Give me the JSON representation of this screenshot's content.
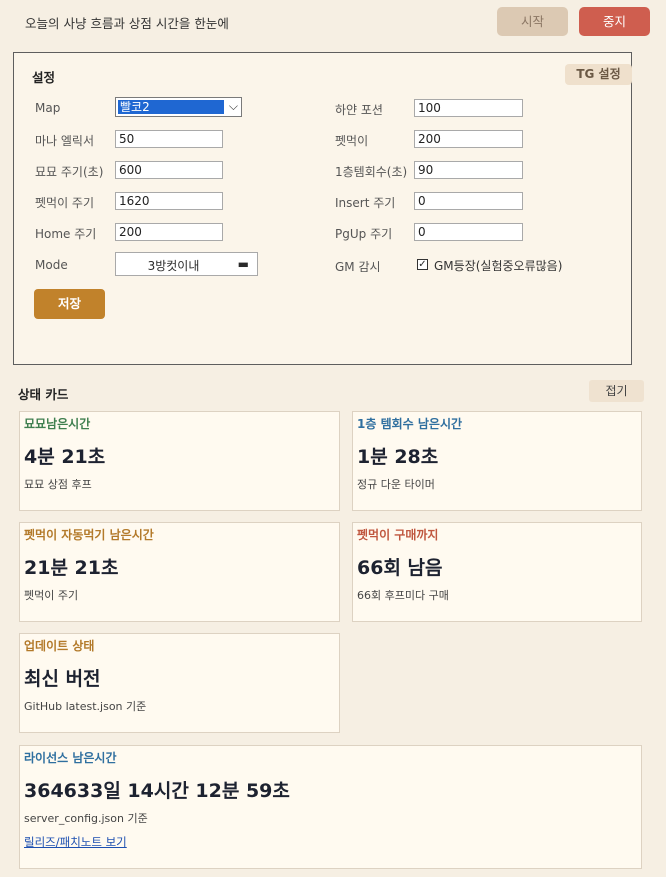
{
  "header": {
    "title": "오늘의 사냥 흐름과 상점 시간을 한눈에",
    "start_label": "시작",
    "stop_label": "중지"
  },
  "settings": {
    "title": "설정",
    "tg_button": "TG 설정",
    "map_label": "Map",
    "map_value": "빨코2",
    "mana_label": "마나 엘릭서",
    "mana_value": "50",
    "myomyo_label": "묘묘 주기(초)",
    "myomyo_value": "600",
    "pet_cycle_label": "펫먹이 주기",
    "pet_cycle_value": "1620",
    "home_label": "Home 주기",
    "home_value": "200",
    "mode_label": "Mode",
    "mode_value": "3방컷이내",
    "white_potion_label": "하얀 포션",
    "white_potion_value": "100",
    "pet_food_label": "펫먹이",
    "pet_food_value": "200",
    "floor1_label": "1층템회수(초)",
    "floor1_value": "90",
    "insert_label": "Insert 주기",
    "insert_value": "0",
    "pgup_label": "PgUp 주기",
    "pgup_value": "0",
    "gm_label": "GM 감시",
    "gm_check_label": "GM등장(실험중오류많음)",
    "gm_checked": true,
    "save_label": "저장"
  },
  "status": {
    "title": "상태 카드",
    "collapse_label": "접기",
    "cards": [
      {
        "title": "묘묘남은시간",
        "value": "4분 21초",
        "sub": "묘묘 상점 후프",
        "color": "#3f7f4f"
      },
      {
        "title": "1층 템회수 남은시간",
        "value": "1분 28초",
        "sub": "정규 다운 타이머",
        "color": "#2f6f9f"
      },
      {
        "title": "펫먹이 자동먹기 남은시간",
        "value": "21분 21초",
        "sub": "펫먹이 주기",
        "color": "#b37a2a"
      },
      {
        "title": "펫먹이 구매까지",
        "value": "66회 남음",
        "sub": "66회 후프미다 구매",
        "color": "#c0573f"
      },
      {
        "title": "업데이트 상태",
        "value": "최신 버전",
        "sub": "GitHub latest.json 기준",
        "color": "#b37a2a"
      },
      {
        "title": "라이선스 남은시간",
        "value": "364633일 14시간 12분 59초",
        "sub": "server_config.json 기준",
        "link": "릴리즈/패치노트 보기",
        "color": "#2f6f9f"
      }
    ]
  }
}
